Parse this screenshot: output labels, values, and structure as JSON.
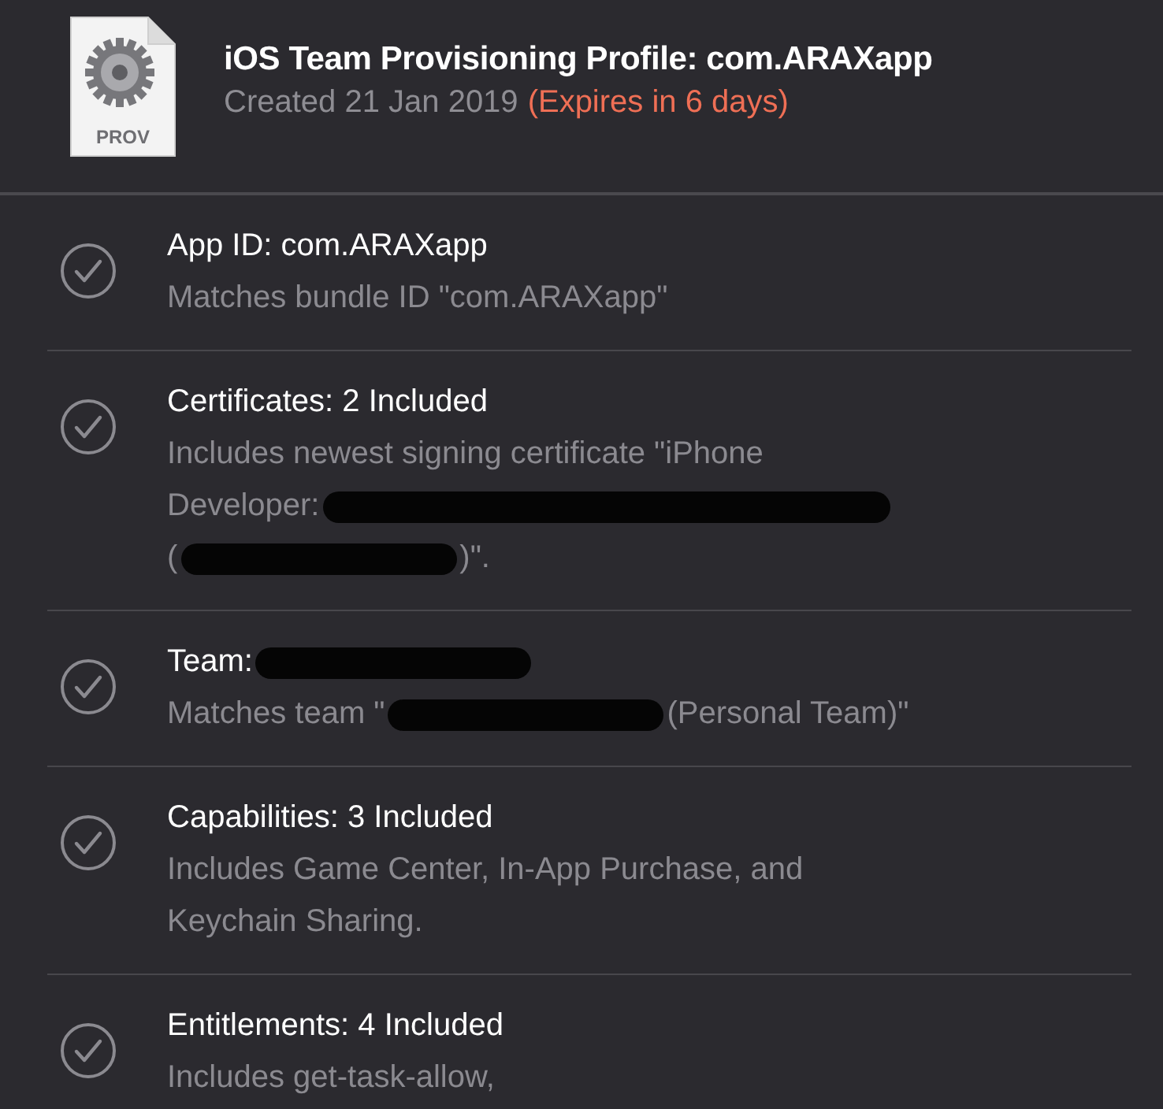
{
  "header": {
    "file_icon_label": "PROV",
    "title": "iOS Team Provisioning Profile: com.ARAXapp",
    "created": "Created 21 Jan 2019",
    "expiry": "(Expires in 6 days)"
  },
  "items": [
    {
      "checked": true,
      "title": [
        {
          "kind": "text",
          "text": "App ID: com.ARAXapp"
        }
      ],
      "lines": [
        [
          {
            "kind": "text",
            "text": "Matches bundle ID \"com.ARAXapp\""
          }
        ]
      ]
    },
    {
      "checked": true,
      "title": [
        {
          "kind": "text",
          "text": "Certificates: 2 Included"
        }
      ],
      "lines": [
        [
          {
            "kind": "text",
            "text": "Includes newest signing certificate \"iPhone"
          }
        ],
        [
          {
            "kind": "text",
            "text": "Developer:"
          },
          {
            "kind": "longredaction"
          }
        ],
        [
          {
            "kind": "text",
            "text": "("
          },
          {
            "kind": "redaction"
          },
          {
            "kind": "text",
            "text": ")\"."
          }
        ]
      ]
    },
    {
      "checked": true,
      "title": [
        {
          "kind": "text",
          "text": "Team:"
        },
        {
          "kind": "redaction"
        }
      ],
      "lines": [
        [
          {
            "kind": "text",
            "text": "Matches team \""
          },
          {
            "kind": "redaction"
          },
          {
            "kind": "text",
            "text": "(Personal Team)\""
          }
        ]
      ]
    },
    {
      "checked": true,
      "title": [
        {
          "kind": "text",
          "text": "Capabilities: 3 Included"
        }
      ],
      "lines": [
        [
          {
            "kind": "text",
            "text": "Includes Game Center, In-App Purchase, and"
          }
        ],
        [
          {
            "kind": "text",
            "text": "Keychain Sharing."
          }
        ]
      ]
    },
    {
      "checked": true,
      "title": [
        {
          "kind": "text",
          "text": "Entitlements: 4 Included"
        }
      ],
      "lines": [
        [
          {
            "kind": "text",
            "text": "Includes get-task-allow,"
          }
        ]
      ]
    }
  ]
}
